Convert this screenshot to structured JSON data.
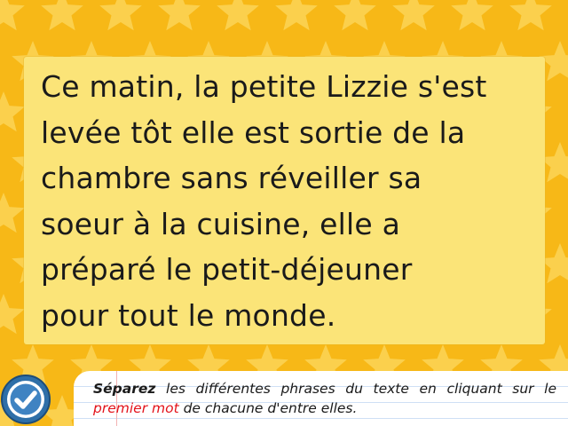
{
  "passage": {
    "lines": [
      [
        "Ce",
        "matin,",
        "la",
        "petite",
        "Lizzie",
        "s'est"
      ],
      [
        "levée",
        "tôt",
        "elle",
        "est",
        "sortie",
        "de",
        "la"
      ],
      [
        "chambre",
        "sans",
        "réveiller",
        "sa"
      ],
      [
        "soeur",
        "à",
        "la",
        "cuisine,",
        "elle",
        "a"
      ],
      [
        "préparé",
        "le",
        "petit-déjeuner"
      ],
      [
        "pour",
        "tout",
        "le",
        "monde."
      ]
    ]
  },
  "instruction": {
    "verb": "Séparez",
    "part1": "les différentes phrases du texte en cliquant sur le",
    "highlight": "premier mot",
    "part2": "de chacune d'entre elles."
  },
  "validate_button": {
    "icon": "checkmark-icon"
  },
  "colors": {
    "background": "#f7b817",
    "panel": "#fbe478",
    "text": "#1a1a1a",
    "highlight": "#e3131b",
    "button": "#2e6fa8"
  }
}
